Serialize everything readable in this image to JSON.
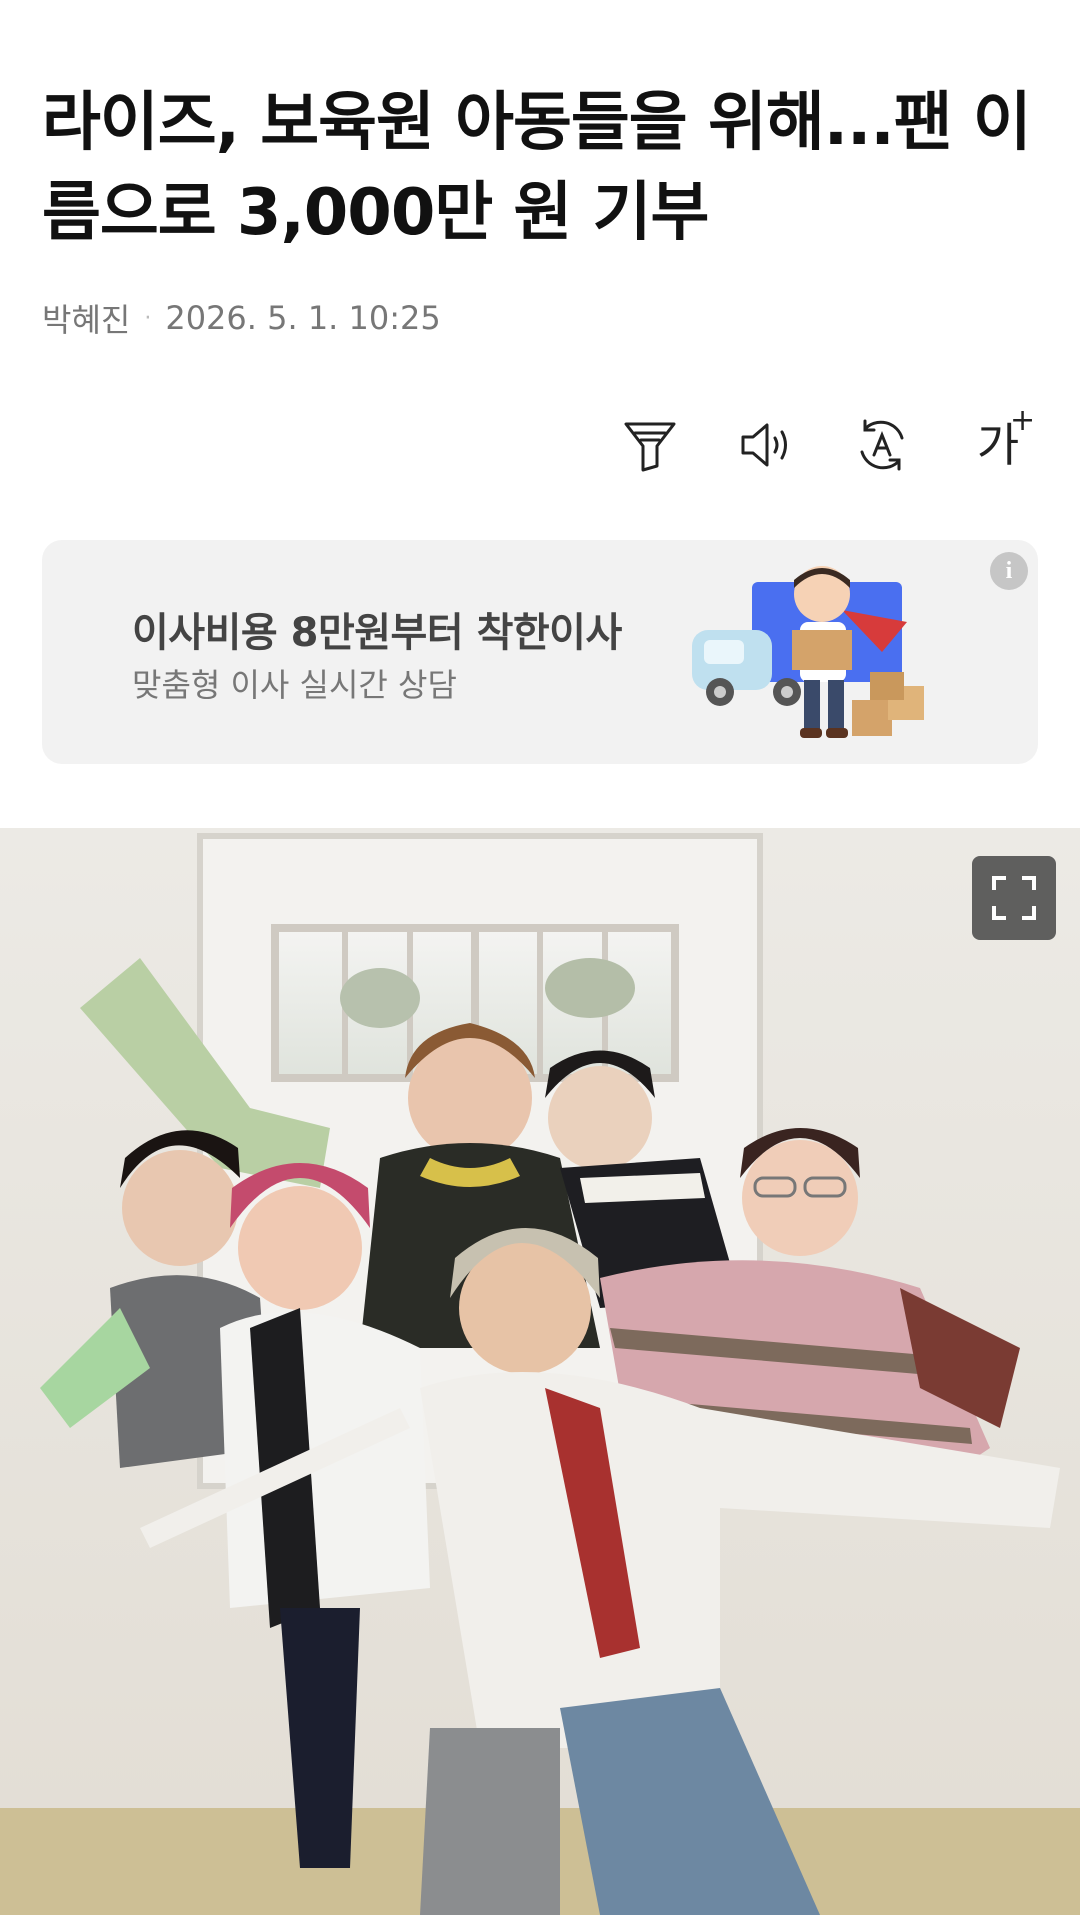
{
  "article": {
    "headline": "라이즈, 보육원 아동들을 위해...팬 이름으로 3,000만 원 기부",
    "author": "박혜진",
    "separator": "·",
    "datetime": "2026. 5. 1. 10:25"
  },
  "toolbar": {
    "icons": [
      "filter-icon",
      "speaker-icon",
      "translate-icon",
      "font-size-icon"
    ],
    "font_size_label": "가",
    "font_size_plus": "+"
  },
  "ad": {
    "title": "이사비용 8만원부터 착한이사",
    "subtitle": "맞춤형 이사 실시간 상담",
    "info_label": "i"
  },
  "photo": {
    "expand_icon": "fullscreen-icon"
  },
  "colors": {
    "headline": "#111111",
    "meta": "#777777",
    "ad_background": "#f2f2f2"
  }
}
